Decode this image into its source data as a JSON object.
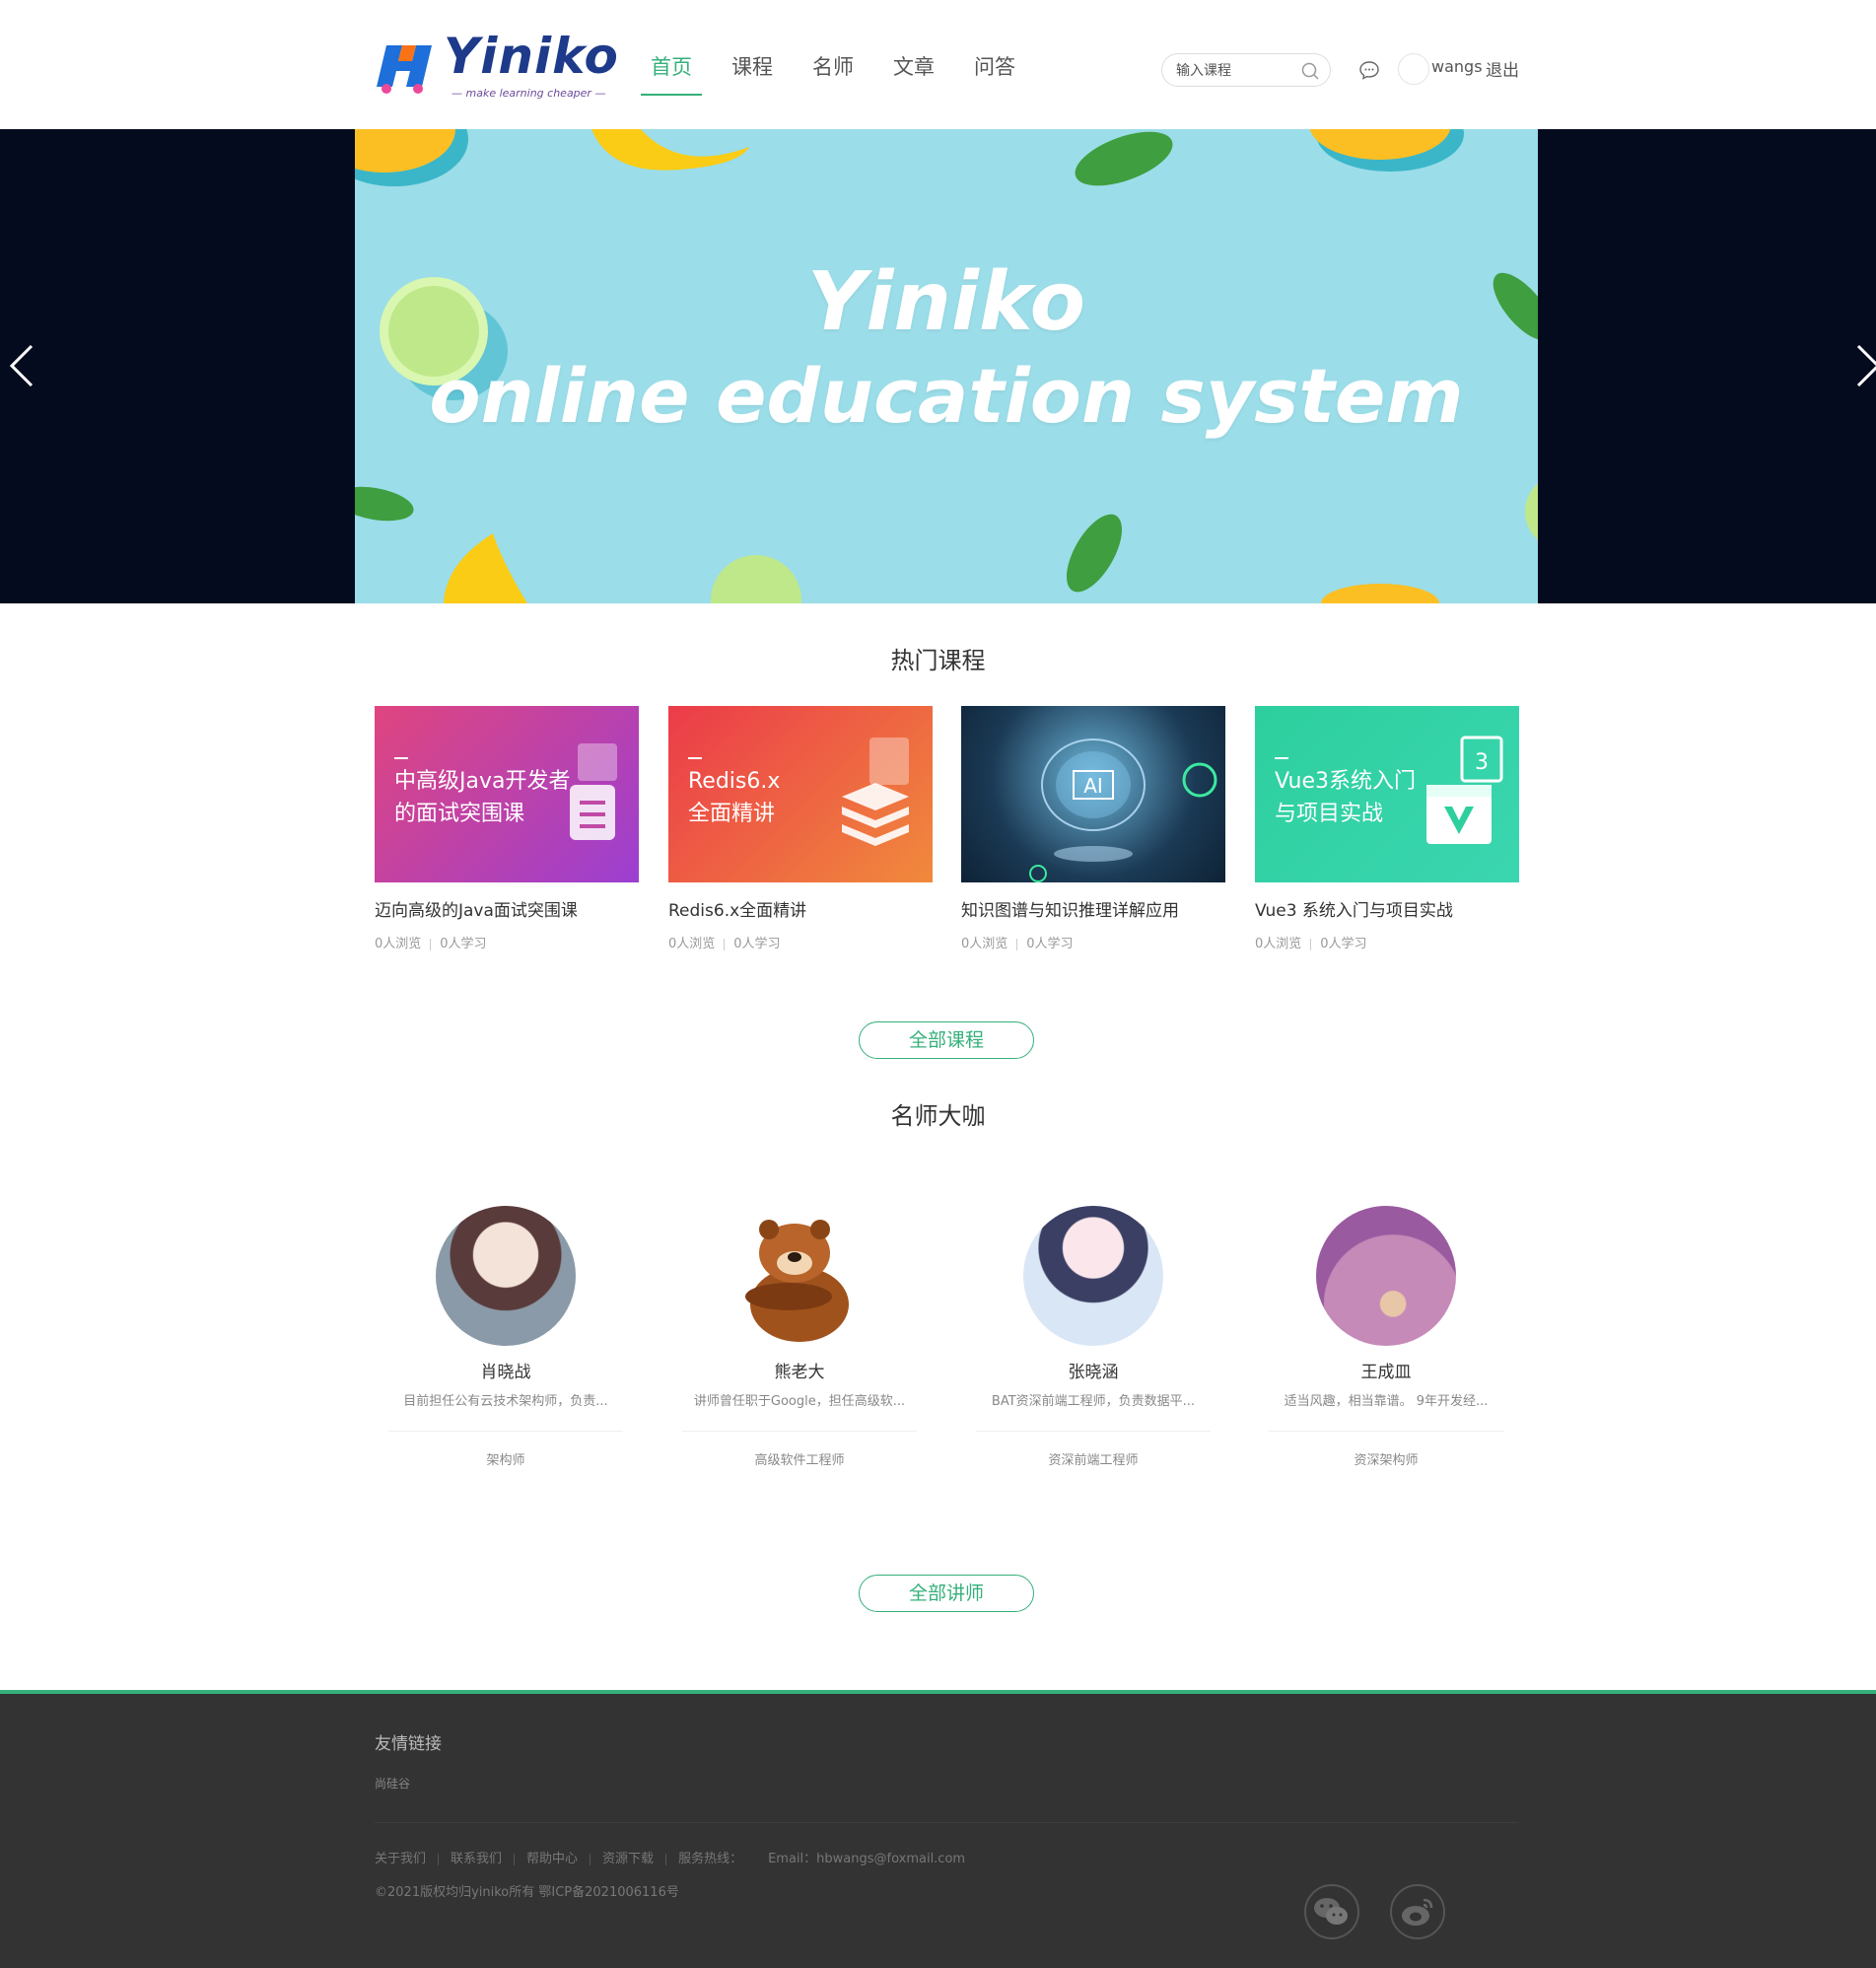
{
  "header": {
    "logo_text": "Yiniko",
    "logo_tagline": "— make learning cheaper —",
    "nav": [
      "首页",
      "课程",
      "名师",
      "文章",
      "问答"
    ],
    "search_placeholder": "输入课程",
    "username": "wangs",
    "logout_label": "退出"
  },
  "banner": {
    "title_line1": "Yiniko",
    "title_line2": "online education system"
  },
  "hot_courses": {
    "title": "热门课程",
    "items": [
      {
        "name": "迈向高级的Java面试突围课",
        "cover_text": "中高级Java开发者\n的面试突围课",
        "views": "0人浏览",
        "learners": "0人学习"
      },
      {
        "name": "Redis6.x全面精讲",
        "cover_text": "Redis6.x\n全面精讲",
        "views": "0人浏览",
        "learners": "0人学习"
      },
      {
        "name": "知识图谱与知识推理详解应用",
        "cover_text": "",
        "views": "0人浏览",
        "learners": "0人学习"
      },
      {
        "name": "Vue3 系统入门与项目实战",
        "cover_text": "Vue3系统入门\n与项目实战",
        "views": "0人浏览",
        "learners": "0人学习"
      }
    ],
    "all_button": "全部课程"
  },
  "teachers": {
    "title": "名师大咖",
    "items": [
      {
        "name": "肖晓战",
        "desc": "目前担任公有云技术架构师，负责...",
        "title": "架构师"
      },
      {
        "name": "熊老大",
        "desc": "讲师曾任职于Google，担任高级软...",
        "title": "高级软件工程师"
      },
      {
        "name": "张晓涵",
        "desc": "BAT资深前端工程师，负责数据平...",
        "title": "资深前端工程师"
      },
      {
        "name": "王成皿",
        "desc": "适当风趣，相当靠谱。 9年开发经...",
        "title": "资深架构师"
      }
    ],
    "all_button": "全部讲师"
  },
  "footer": {
    "links_title": "友情链接",
    "friend_link": "尚硅谷",
    "nav": [
      "关于我们",
      "联系我们",
      "帮助中心",
      "资源下载",
      "服务热线：",
      "Email：hbwangs@foxmail.com"
    ],
    "copyright": "©2021版权均归yiniko所有 鄂ICP备2021006116号"
  },
  "colors": {
    "accent": "#35b07a",
    "footer_bg": "#333333",
    "banner_bg": "#9bdde8"
  }
}
